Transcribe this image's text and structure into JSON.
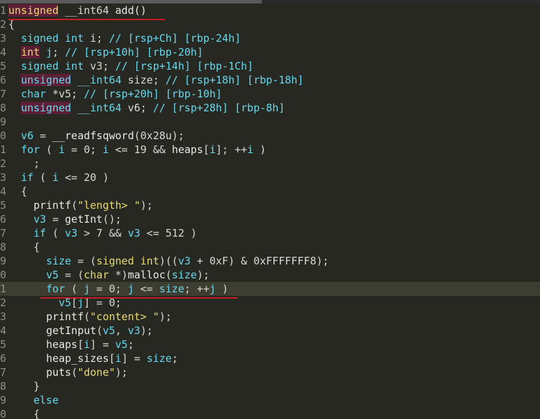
{
  "editor": {
    "lines": [
      {
        "n": "1",
        "tokens": [
          [
            "kwd",
            "unsigned"
          ],
          [
            "pl",
            " __int64 "
          ],
          [
            "fn",
            "add()"
          ]
        ]
      },
      {
        "n": "2",
        "tokens": [
          [
            "pl",
            "{"
          ]
        ]
      },
      {
        "n": "3",
        "tokens": [
          [
            "pl",
            "  "
          ],
          [
            "kw",
            "signed int"
          ],
          [
            "pl",
            " i; "
          ],
          [
            "cm",
            "// [rsp+Ch] [rbp-24h]"
          ]
        ]
      },
      {
        "n": "4",
        "tokens": [
          [
            "pl",
            "  "
          ],
          [
            "kwd",
            "int"
          ],
          [
            "pl",
            " "
          ],
          [
            "var",
            "j"
          ],
          [
            "pl",
            "; "
          ],
          [
            "cm",
            "// [rsp+10h] [rbp-20h]"
          ]
        ]
      },
      {
        "n": "5",
        "tokens": [
          [
            "pl",
            "  "
          ],
          [
            "kw",
            "signed int"
          ],
          [
            "pl",
            " v3; "
          ],
          [
            "cm",
            "// [rsp+14h] [rbp-1Ch]"
          ]
        ]
      },
      {
        "n": "6",
        "tokens": [
          [
            "pl",
            "  "
          ],
          [
            "kwh",
            "unsigned"
          ],
          [
            "pl",
            " "
          ],
          [
            "kw",
            "__int64"
          ],
          [
            "pl",
            " size; "
          ],
          [
            "cm",
            "// [rsp+18h] [rbp-18h]"
          ]
        ]
      },
      {
        "n": "7",
        "tokens": [
          [
            "pl",
            "  "
          ],
          [
            "kw",
            "char"
          ],
          [
            "pl",
            " *v5; "
          ],
          [
            "cm",
            "// [rsp+20h] [rbp-10h]"
          ]
        ]
      },
      {
        "n": "8",
        "tokens": [
          [
            "pl",
            "  "
          ],
          [
            "kwh",
            "unsigned"
          ],
          [
            "pl",
            " "
          ],
          [
            "kw",
            "__int64"
          ],
          [
            "pl",
            " v6; "
          ],
          [
            "cm",
            "// [rsp+28h] [rbp-8h]"
          ]
        ]
      },
      {
        "n": "9",
        "tokens": []
      },
      {
        "n": "0",
        "tokens": [
          [
            "pl",
            "  "
          ],
          [
            "var",
            "v6"
          ],
          [
            "pl",
            " = "
          ],
          [
            "fn",
            "__readfsqword"
          ],
          [
            "pl",
            "(0x28u);"
          ]
        ]
      },
      {
        "n": "1",
        "tokens": [
          [
            "pl",
            "  "
          ],
          [
            "kw",
            "for"
          ],
          [
            "pl",
            " ( "
          ],
          [
            "var",
            "i"
          ],
          [
            "pl",
            " = 0; "
          ],
          [
            "var",
            "i"
          ],
          [
            "pl",
            " <= 19 && "
          ],
          [
            "gv",
            "heaps"
          ],
          [
            "pl",
            "["
          ],
          [
            "var",
            "i"
          ],
          [
            "pl",
            "]; ++"
          ],
          [
            "var",
            "i"
          ],
          [
            "pl",
            " )"
          ]
        ]
      },
      {
        "n": "2",
        "tokens": [
          [
            "pl",
            "    ;"
          ]
        ]
      },
      {
        "n": "3",
        "tokens": [
          [
            "pl",
            "  "
          ],
          [
            "kw",
            "if"
          ],
          [
            "pl",
            " ( "
          ],
          [
            "var",
            "i"
          ],
          [
            "pl",
            " <= 20 )"
          ]
        ]
      },
      {
        "n": "4",
        "tokens": [
          [
            "pl",
            "  {"
          ]
        ]
      },
      {
        "n": "5",
        "tokens": [
          [
            "pl",
            "    "
          ],
          [
            "fn",
            "printf"
          ],
          [
            "pl",
            "("
          ],
          [
            "str",
            "\"length> \""
          ],
          [
            "pl",
            ");"
          ]
        ]
      },
      {
        "n": "6",
        "tokens": [
          [
            "pl",
            "    "
          ],
          [
            "var",
            "v3"
          ],
          [
            "pl",
            " = "
          ],
          [
            "fn",
            "getInt"
          ],
          [
            "pl",
            "();"
          ]
        ]
      },
      {
        "n": "7",
        "tokens": [
          [
            "pl",
            "    "
          ],
          [
            "kw",
            "if"
          ],
          [
            "pl",
            " ( "
          ],
          [
            "var",
            "v3"
          ],
          [
            "pl",
            " > 7 && "
          ],
          [
            "var",
            "v3"
          ],
          [
            "pl",
            " <= 512 )"
          ]
        ]
      },
      {
        "n": "8",
        "tokens": [
          [
            "pl",
            "    {"
          ]
        ]
      },
      {
        "n": "9",
        "tokens": [
          [
            "pl",
            "      "
          ],
          [
            "var",
            "size"
          ],
          [
            "pl",
            " = ("
          ],
          [
            "str",
            "signed int"
          ],
          [
            "pl",
            ")(("
          ],
          [
            "var",
            "v3"
          ],
          [
            "pl",
            " + 0xF) & 0xFFFFFFF8);"
          ]
        ]
      },
      {
        "n": "0",
        "tokens": [
          [
            "pl",
            "      "
          ],
          [
            "var",
            "v5"
          ],
          [
            "pl",
            " = ("
          ],
          [
            "str",
            "char"
          ],
          [
            "pl",
            " *)"
          ],
          [
            "fn",
            "malloc"
          ],
          [
            "pl",
            "("
          ],
          [
            "var",
            "size"
          ],
          [
            "pl",
            ");"
          ]
        ]
      },
      {
        "n": "1",
        "current": true,
        "tokens": [
          [
            "pl",
            "      "
          ],
          [
            "kw",
            "for"
          ],
          [
            "pl",
            " ( "
          ],
          [
            "var",
            "j"
          ],
          [
            "pl",
            " = 0; "
          ],
          [
            "var",
            "j"
          ],
          [
            "pl",
            " <= "
          ],
          [
            "var",
            "size"
          ],
          [
            "pl",
            "; ++"
          ],
          [
            "var",
            "j"
          ],
          [
            "pl",
            " )"
          ]
        ]
      },
      {
        "n": "2",
        "tokens": [
          [
            "pl",
            "        "
          ],
          [
            "var",
            "v5"
          ],
          [
            "pl",
            "["
          ],
          [
            "var",
            "j"
          ],
          [
            "pl",
            "] = 0;"
          ]
        ]
      },
      {
        "n": "3",
        "tokens": [
          [
            "pl",
            "      "
          ],
          [
            "fn",
            "printf"
          ],
          [
            "pl",
            "("
          ],
          [
            "str",
            "\"content> \""
          ],
          [
            "pl",
            ");"
          ]
        ]
      },
      {
        "n": "4",
        "tokens": [
          [
            "pl",
            "      "
          ],
          [
            "fn",
            "getInput"
          ],
          [
            "pl",
            "("
          ],
          [
            "var",
            "v5"
          ],
          [
            "pl",
            ", "
          ],
          [
            "var",
            "v3"
          ],
          [
            "pl",
            ");"
          ]
        ]
      },
      {
        "n": "5",
        "tokens": [
          [
            "pl",
            "      "
          ],
          [
            "gv",
            "heaps"
          ],
          [
            "pl",
            "["
          ],
          [
            "var",
            "i"
          ],
          [
            "pl",
            "] = "
          ],
          [
            "var",
            "v5"
          ],
          [
            "pl",
            ";"
          ]
        ]
      },
      {
        "n": "6",
        "tokens": [
          [
            "pl",
            "      "
          ],
          [
            "gv",
            "heap_sizes"
          ],
          [
            "pl",
            "["
          ],
          [
            "var",
            "i"
          ],
          [
            "pl",
            "] = "
          ],
          [
            "var",
            "size"
          ],
          [
            "pl",
            ";"
          ]
        ]
      },
      {
        "n": "7",
        "tokens": [
          [
            "pl",
            "      "
          ],
          [
            "fn",
            "puts"
          ],
          [
            "pl",
            "("
          ],
          [
            "str",
            "\"done\""
          ],
          [
            "pl",
            ");"
          ]
        ]
      },
      {
        "n": "8",
        "tokens": [
          [
            "pl",
            "    }"
          ]
        ]
      },
      {
        "n": "9",
        "tokens": [
          [
            "pl",
            "    "
          ],
          [
            "kw",
            "else"
          ]
        ]
      },
      {
        "n": "0",
        "tokens": [
          [
            "pl",
            "    {"
          ]
        ]
      }
    ]
  },
  "colors": {
    "background": "#272822",
    "keyword": "#66d9ef",
    "string": "#e6db74",
    "highlight": "#5c1f36",
    "annotation_underline": "#c81d25"
  }
}
